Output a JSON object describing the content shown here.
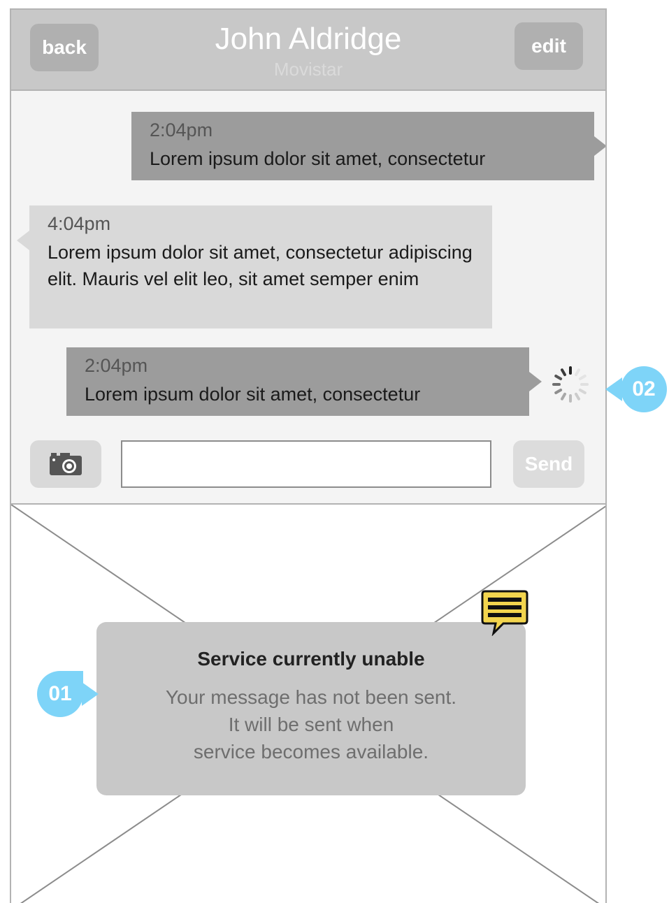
{
  "header": {
    "back_label": "back",
    "edit_label": "edit",
    "contact_name": "John Aldridge",
    "carrier": "Movistar"
  },
  "messages": [
    {
      "direction": "outgoing",
      "time": "2:04pm",
      "text": "Lorem ipsum dolor sit amet, consectetur"
    },
    {
      "direction": "incoming",
      "time": "4:04pm",
      "text": "Lorem ipsum dolor sit amet, consectetur adipiscing elit. Mauris vel elit leo, sit amet semper enim"
    },
    {
      "direction": "outgoing",
      "time": "2:04pm",
      "text": "Lorem ipsum dolor sit amet, consectetur",
      "status": "sending"
    }
  ],
  "composer": {
    "input_value": "",
    "send_label": "Send",
    "camera_icon": "camera-icon"
  },
  "dialog": {
    "title": "Service currently unable",
    "line1": "Your message has not been sent.",
    "line2": "It will be sent when",
    "line3": "service becomes available."
  },
  "annotations": {
    "marker_01": "01",
    "marker_02": "02",
    "note_icon": "note-icon"
  },
  "colors": {
    "header_bg": "#c8c8c8",
    "outgoing_bubble": "#9c9c9c",
    "incoming_bubble": "#d9d9d9",
    "dialog_bg": "#c8c8c8",
    "marker": "#7ed4f8",
    "note": "#f3d54e"
  }
}
